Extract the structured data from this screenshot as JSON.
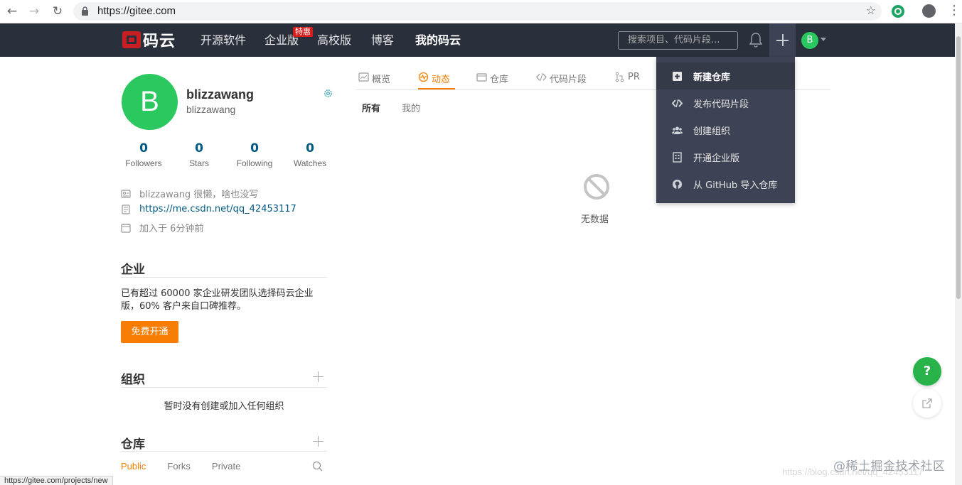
{
  "browser": {
    "url": "https://gitee.com",
    "status_url": "https://gitee.com/projects/new"
  },
  "header": {
    "logo_text": "码云",
    "nav": [
      {
        "label": "开源软件"
      },
      {
        "label": "企业版",
        "badge": "特惠"
      },
      {
        "label": "高校版"
      },
      {
        "label": "博客"
      },
      {
        "label": "我的码云"
      }
    ],
    "search_placeholder": "搜索项目、代码片段...",
    "avatar_letter": "B"
  },
  "profile": {
    "avatar_letter": "B",
    "name": "blizzawang",
    "login": "blizzawang",
    "stats": [
      {
        "value": "0",
        "label": "Followers"
      },
      {
        "value": "0",
        "label": "Stars"
      },
      {
        "value": "0",
        "label": "Following"
      },
      {
        "value": "0",
        "label": "Watches"
      }
    ],
    "bio": "blizzawang 很懒，啥也没写",
    "blog": "https://me.csdn.net/qq_42453117",
    "joined": "加入于 6分钟前"
  },
  "enterprise": {
    "title": "企业",
    "text": "已有超过 60000 家企业研发团队选择码云企业版，60% 客户来自口碑推荐。",
    "button": "免费开通"
  },
  "orgs": {
    "title": "组织",
    "empty": "暂时没有创建或加入任何组织"
  },
  "repos": {
    "title": "仓库",
    "tabs": [
      "Public",
      "Forks",
      "Private"
    ]
  },
  "main": {
    "tabs": [
      {
        "label": "概览",
        "icon": "overview-icon"
      },
      {
        "label": "动态",
        "icon": "activity-icon",
        "active": true
      },
      {
        "label": "仓库",
        "icon": "repo-icon"
      },
      {
        "label": "代码片段",
        "icon": "code-icon"
      },
      {
        "label": "PR",
        "icon": "pull-request-icon"
      }
    ],
    "sub_tabs": [
      "所有",
      "我的"
    ],
    "empty_text": "无数据"
  },
  "dropdown": {
    "items": [
      {
        "label": "新建仓库",
        "icon": "plus-square-icon"
      },
      {
        "label": "发布代码片段",
        "icon": "code-icon"
      },
      {
        "label": "创建组织",
        "icon": "group-icon"
      },
      {
        "label": "开通企业版",
        "icon": "building-icon"
      },
      {
        "label": "从 GitHub 导入仓库",
        "icon": "github-icon"
      }
    ]
  },
  "floating": {
    "help": "?"
  },
  "watermark": {
    "text": "@稀土掘金技术社区",
    "url": "https://blog.csdn.net/qq_42453117"
  },
  "colors": {
    "accent": "#f77e02",
    "header_bg": "#2a2f3c",
    "avatar": "#2bc85f",
    "link": "#005980",
    "help": "#27b24a"
  }
}
